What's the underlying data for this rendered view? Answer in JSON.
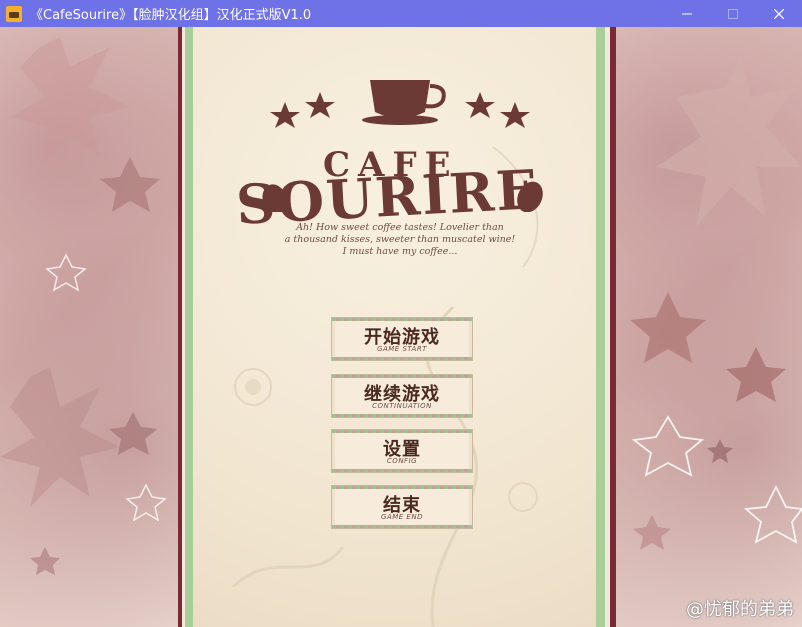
{
  "window": {
    "title": "《CafeSourire》【脸肿汉化组】汉化正式版V1.0",
    "minimize_icon": "minimize-icon",
    "maximize_icon": "maximize-icon",
    "close_icon": "close-icon"
  },
  "logo": {
    "line1": "CAFE",
    "line2": "SOURIRE",
    "tagline_lines": [
      "Ah! How sweet coffee tastes! Lovelier than",
      "a thousand kisses, sweeter than muscatel wine!",
      "I must have my coffee..."
    ]
  },
  "menu": [
    {
      "label": "开始游戏",
      "sub": "GAME START"
    },
    {
      "label": "继续游戏",
      "sub": "CONTINUATION"
    },
    {
      "label": "设置",
      "sub": "CONFIG"
    },
    {
      "label": "结束",
      "sub": "GAME END"
    }
  ],
  "watermark": "@忧郁的弟弟",
  "colors": {
    "titlebar": "#6f72e6",
    "logo_brown": "#6b3a35",
    "accent_green": "#a8cf97",
    "accent_maroon": "#7a2a34"
  }
}
